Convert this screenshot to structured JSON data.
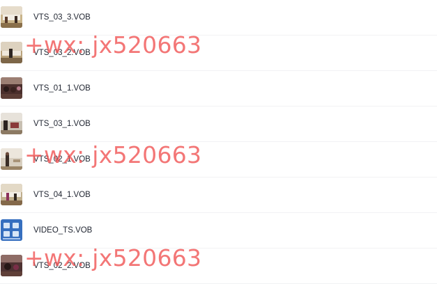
{
  "files": [
    {
      "name": "VTS_03_3.VOB",
      "thumbnail_icon": "video-thumbnail-icon"
    },
    {
      "name": "VTS_03_2.VOB",
      "thumbnail_icon": "video-thumbnail-icon"
    },
    {
      "name": "VTS_01_1.VOB",
      "thumbnail_icon": "video-thumbnail-icon"
    },
    {
      "name": "VTS_03_1.VOB",
      "thumbnail_icon": "video-thumbnail-icon"
    },
    {
      "name": "VTS_02_1.VOB",
      "thumbnail_icon": "video-thumbnail-icon"
    },
    {
      "name": "VTS_04_1.VOB",
      "thumbnail_icon": "video-thumbnail-icon"
    },
    {
      "name": "VIDEO_TS.VOB",
      "thumbnail_icon": "dvd-menu-thumbnail-icon"
    },
    {
      "name": "VTS_02_2.VOB",
      "thumbnail_icon": "video-thumbnail-icon"
    }
  ],
  "watermarks": [
    "+wx: jx520663",
    "+wx: jx520663",
    "+wx: jx520663"
  ],
  "colors": {
    "filename_text": "#1f2430",
    "row_divider": "#f1f2f4",
    "watermark": "#f05050"
  }
}
